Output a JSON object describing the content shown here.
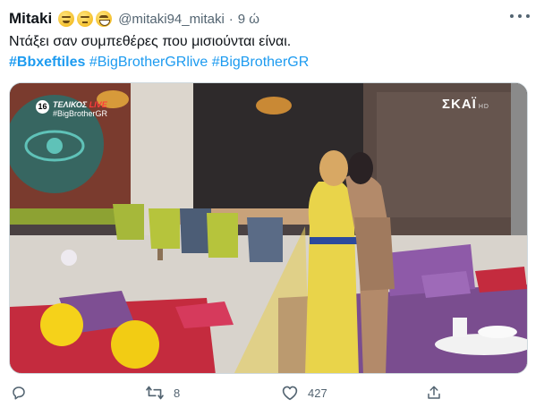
{
  "tweet": {
    "author_name": "Mitaki",
    "emojis": [
      "relieved-face-icon",
      "neutral-face-icon",
      "grinning-face-icon"
    ],
    "handle": "@mitaki94_mitaki",
    "separator": "·",
    "time": "9 ώ",
    "text": "Ντάξει σαν συμπεθέρες που μισιούνται είναι.",
    "hashtags": [
      "#Bbxeftiles",
      "#BigBrotherGRlive",
      "#BigBrotherGR"
    ]
  },
  "media": {
    "age_rating": "16",
    "broadcast_label": "ΤΕΛΙΚΟΣ",
    "live_label": "LIVE",
    "show_tag": "#BigBrotherGR",
    "channel": "ΣΚΑΪ",
    "channel_suffix": "HD"
  },
  "actions": {
    "reply_count": "",
    "retweet_count": "8",
    "like_count": "427"
  },
  "colors": {
    "link": "#1d9bf0",
    "secondary_text": "#536471",
    "primary_text": "#0f1419"
  }
}
